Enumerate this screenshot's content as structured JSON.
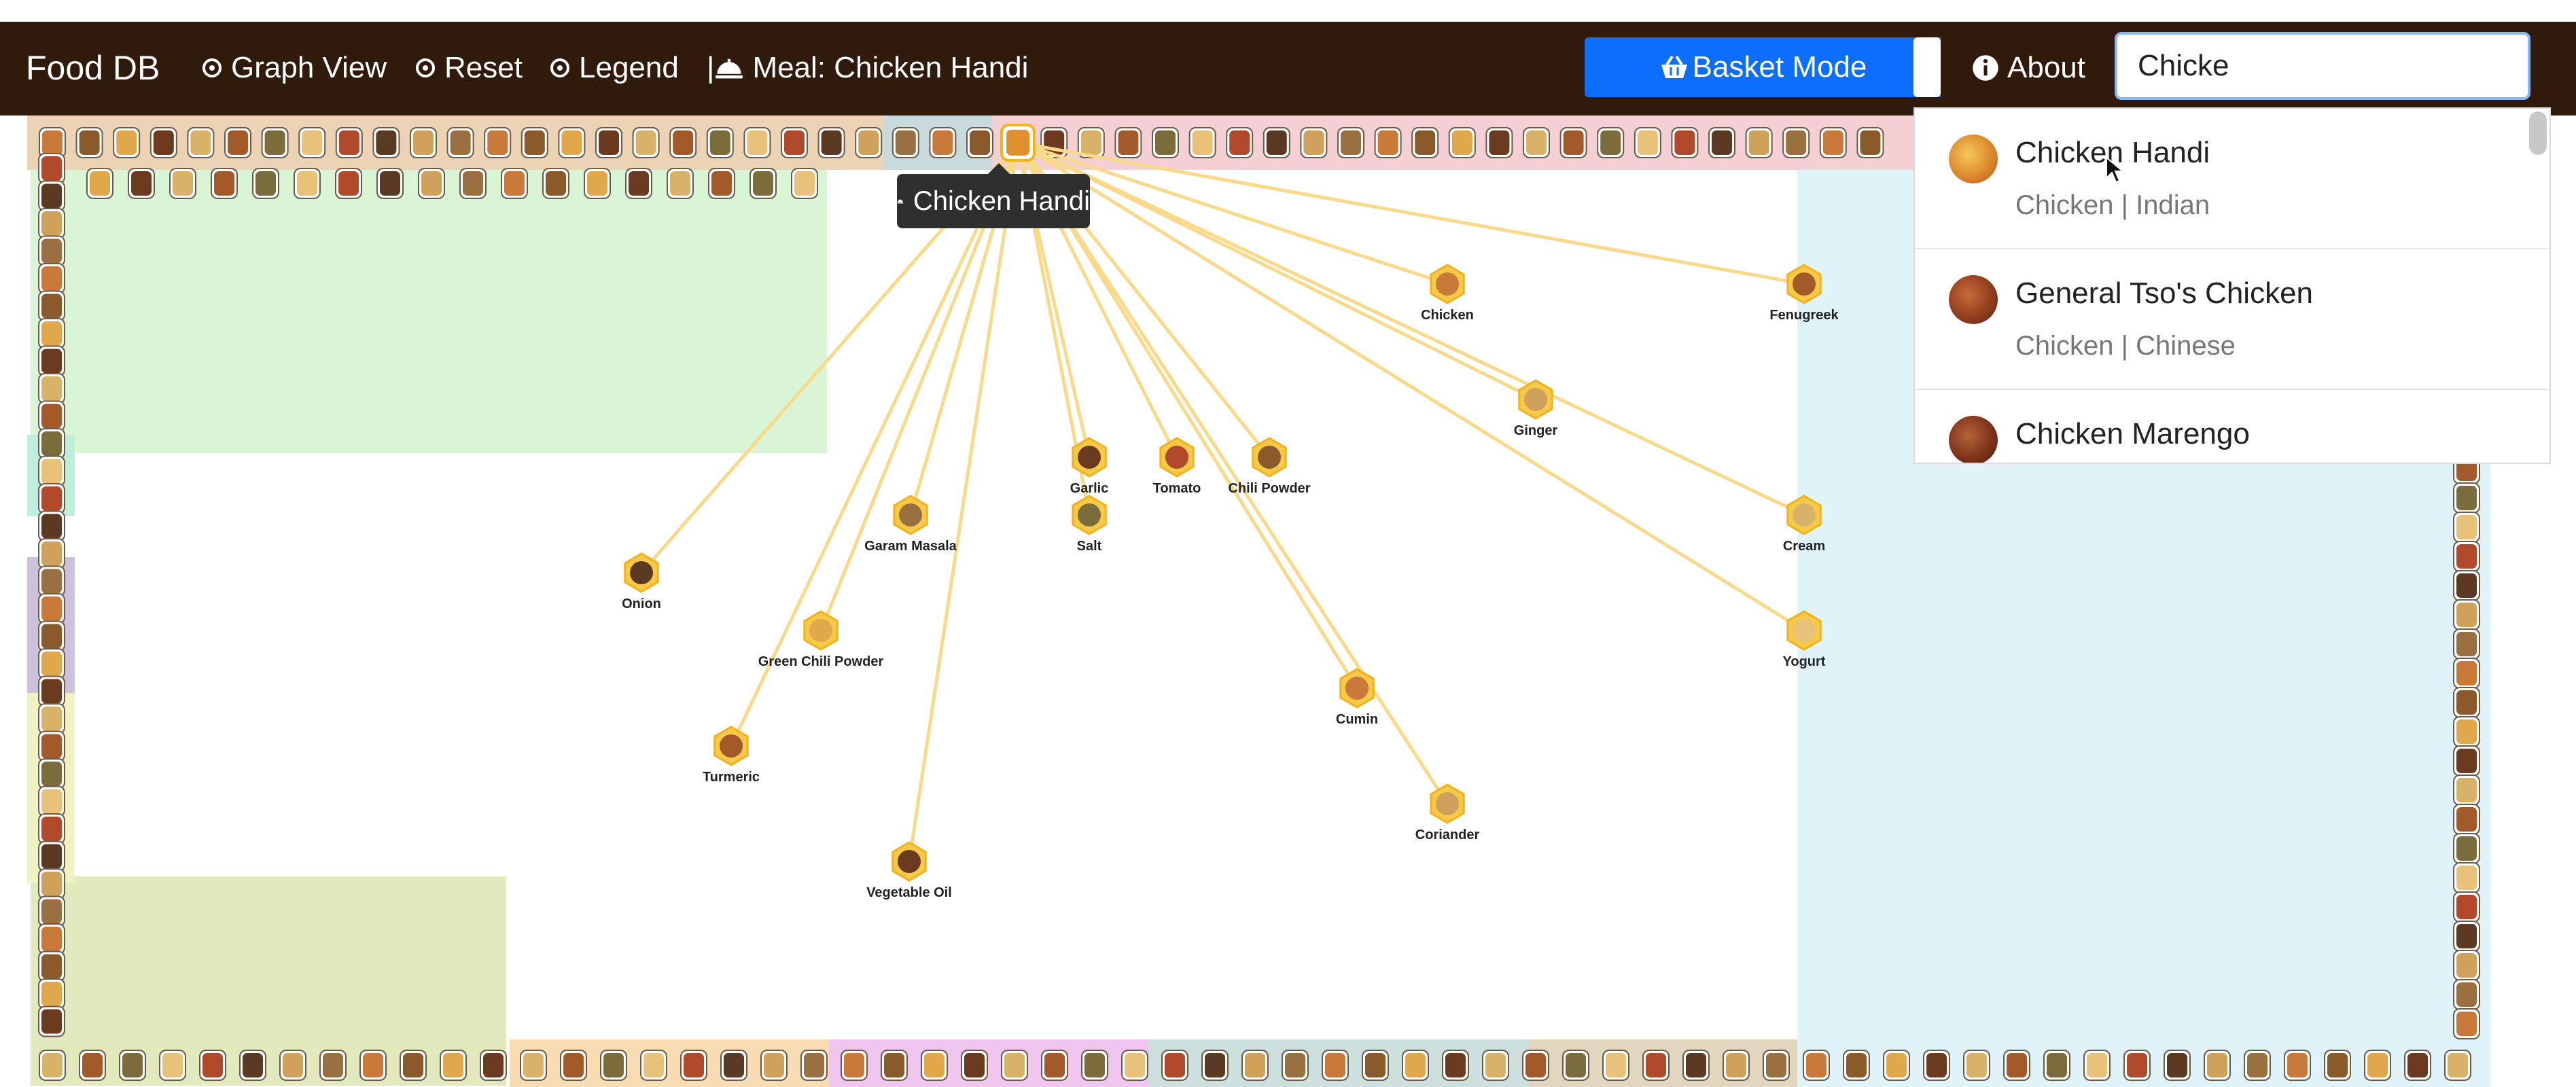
{
  "app": {
    "brand": "Food DB"
  },
  "nav": {
    "graph_view": "Graph View",
    "reset": "Reset",
    "legend": "Legend",
    "meal_prefix": "| ",
    "meal": "Meal: Chicken Handi",
    "basket_mode": "Basket Mode",
    "about": "About"
  },
  "search": {
    "value": "Chicke",
    "placeholder": ""
  },
  "suggestions": [
    {
      "name": "Chicken Handi",
      "meta": "Chicken | Indian"
    },
    {
      "name": "General Tso's Chicken",
      "meta": "Chicken | Chinese"
    },
    {
      "name": "Chicken Marengo",
      "meta": ""
    }
  ],
  "graph": {
    "selected_meal": "Chicken Handi",
    "ingredients": [
      "Chicken",
      "Fenugreek",
      "Ginger",
      "Garlic",
      "Tomato",
      "Chili Powder",
      "Salt",
      "Garam Masala",
      "Cream",
      "Onion",
      "Green Chili Powder",
      "Yogurt",
      "Cumin",
      "Turmeric",
      "Coriander",
      "Vegetable Oil"
    ]
  },
  "colors": {
    "navbar": "#2f1a0c",
    "accent": "#0d6efd",
    "link": "#f9d98a",
    "node_border": "#f2b21c",
    "zone_green": "#d9f5d6",
    "zone_olive": "#e2e9bc",
    "zone_blue": "#dff3f8",
    "zone_pink": "#f4cfd3",
    "zone_tan": "#ecd3b5"
  }
}
